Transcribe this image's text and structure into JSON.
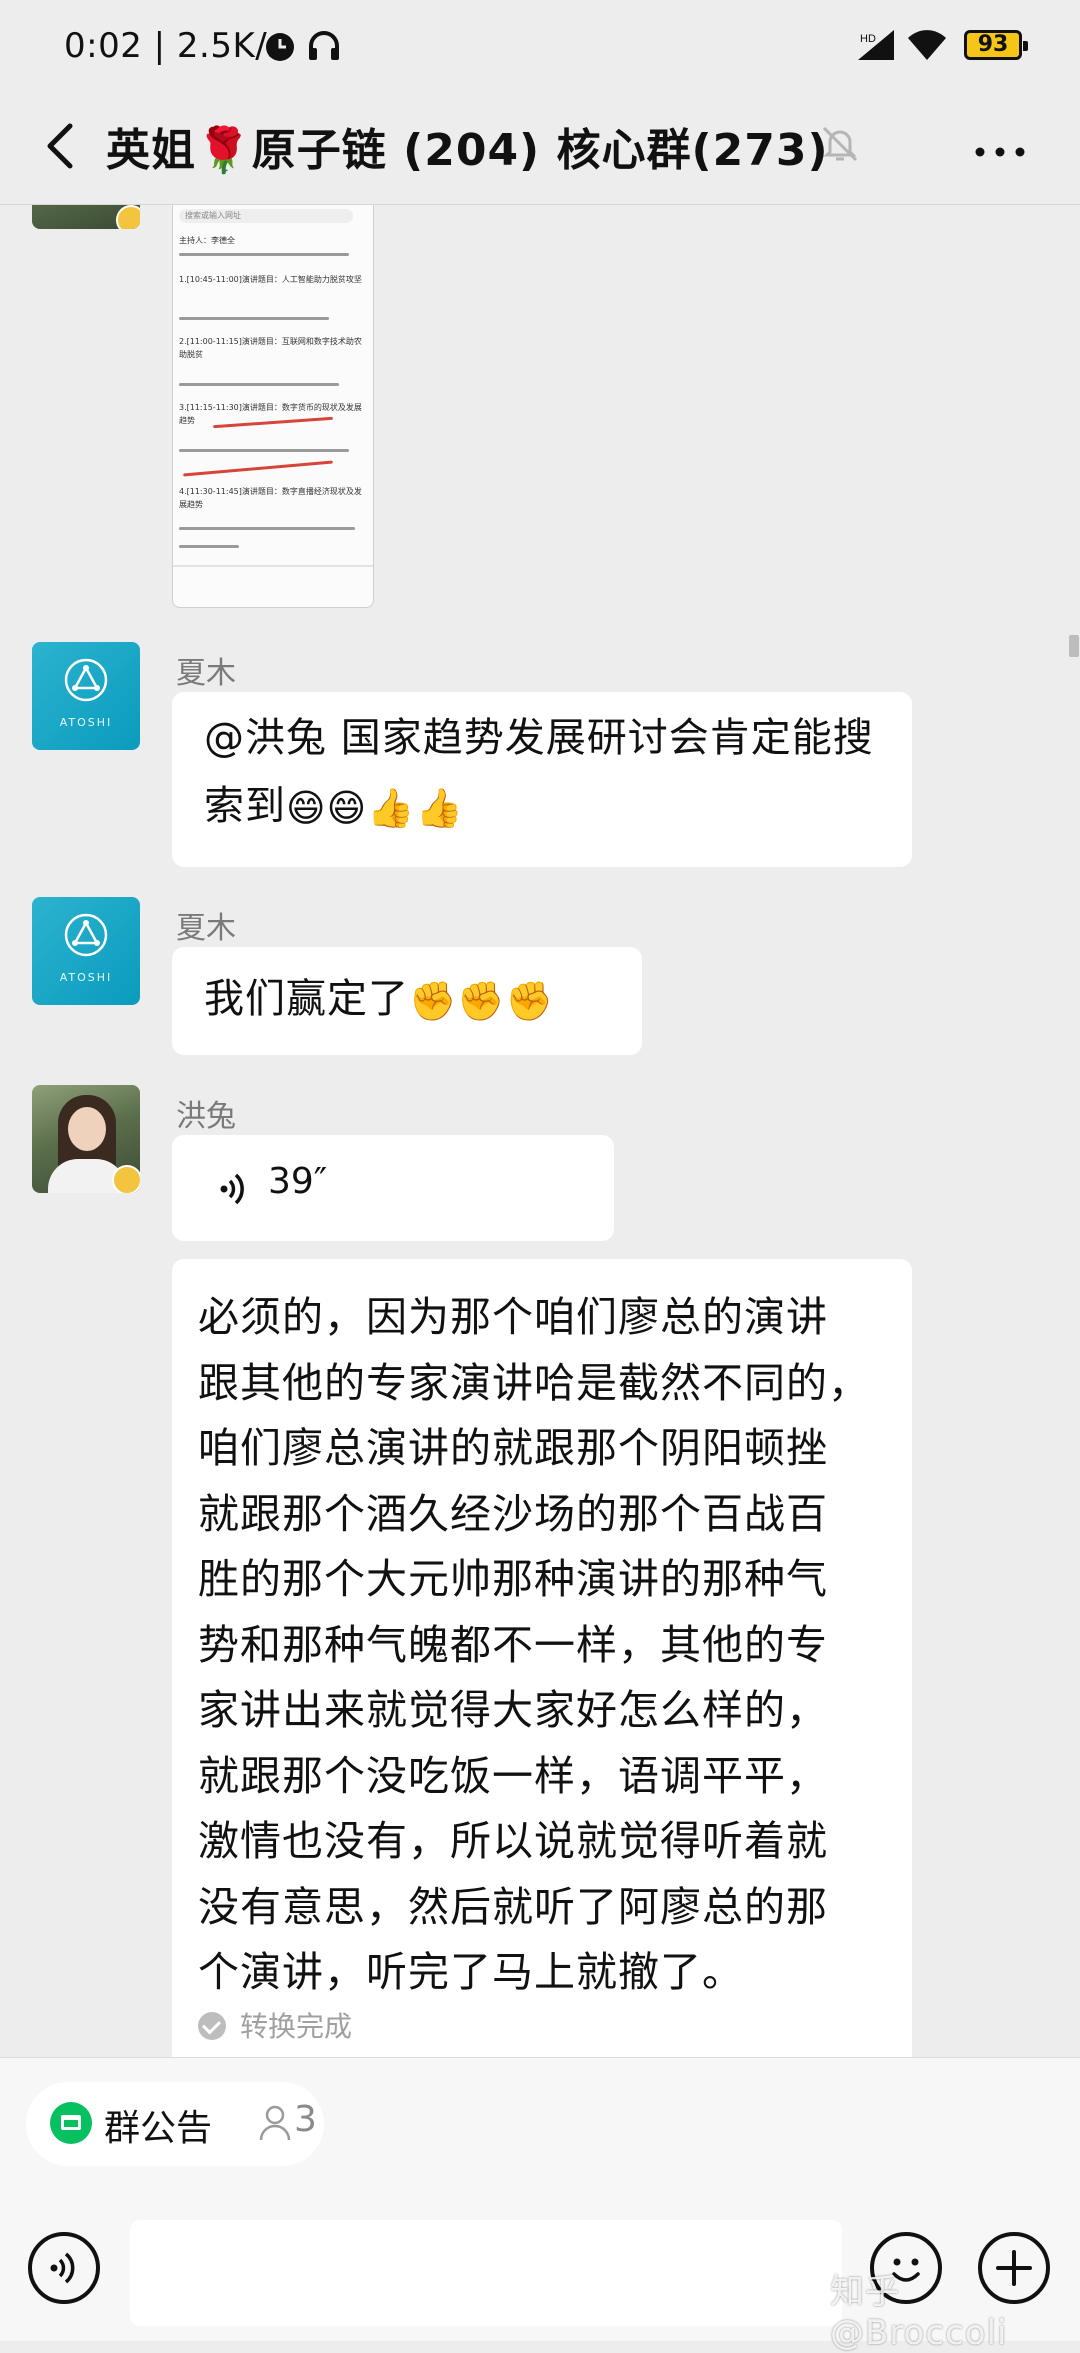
{
  "status_bar": {
    "time": "0:02 | 2.5K/s",
    "battery": "93"
  },
  "header": {
    "title": "英姐🌹原子链 (204) 核心群(273)",
    "icons": [
      "back-arrow-icon",
      "mute-bell-icon",
      "more-dots-icon"
    ]
  },
  "shared_image": {
    "search_placeholder": "搜索或输入网址",
    "lines": [
      "主持人：李德全",
      "1.[10:45-11:00]演讲题目：人工智能助力脱贫攻坚",
      "2.[11:00-11:15]演讲题目：互联网和数字技术助农助脱贫",
      "3.[11:15-11:30]演讲题目：数字货币的现状及发展趋势",
      "4.[11:30-11:45]演讲题目：数字直播经济现状及发展趋势"
    ]
  },
  "messages": [
    {
      "sender": "夏木",
      "avatar_brand": "ATOSHI",
      "text": "@洪兔  国家趋势发展研讨会肯定能搜索到",
      "emojis": [
        "😄",
        "😄",
        "👍",
        "👍"
      ]
    },
    {
      "sender": "夏木",
      "avatar_brand": "ATOSHI",
      "text": "我们赢定了",
      "emojis": [
        "✊",
        "✊",
        "✊"
      ]
    },
    {
      "sender": "洪兔",
      "voice_length": "39″",
      "transcript_lines": [
        "必须的，因为那个咱们廖总的演讲",
        "跟其他的专家演讲哈是截然不同的，",
        "咱们廖总演讲的就跟那个阴阳顿挫",
        "就跟那个酒久经沙场的那个百战百",
        "胜的那个大元帅那种演讲的那种气",
        "势和那种气魄都不一样，其他的专",
        "家讲出来就觉得大家好怎么样的，",
        "就跟那个没吃饭一样，语调平平，",
        "激情也没有，所以说就觉得听着就",
        "没有意思，然后就听了阿廖总的那",
        "个演讲，听完了马上就撤了。"
      ],
      "transcript_status": "转换完成"
    }
  ],
  "bottom": {
    "notice_label": "群公告",
    "notice_count": "3",
    "input_value": "",
    "watermark": "知乎 @Broccoli"
  },
  "colors": {
    "background": "#ededed",
    "bubble": "#ffffff",
    "accent_green": "#07c160",
    "avatar_teal": "#1aa9c7"
  }
}
